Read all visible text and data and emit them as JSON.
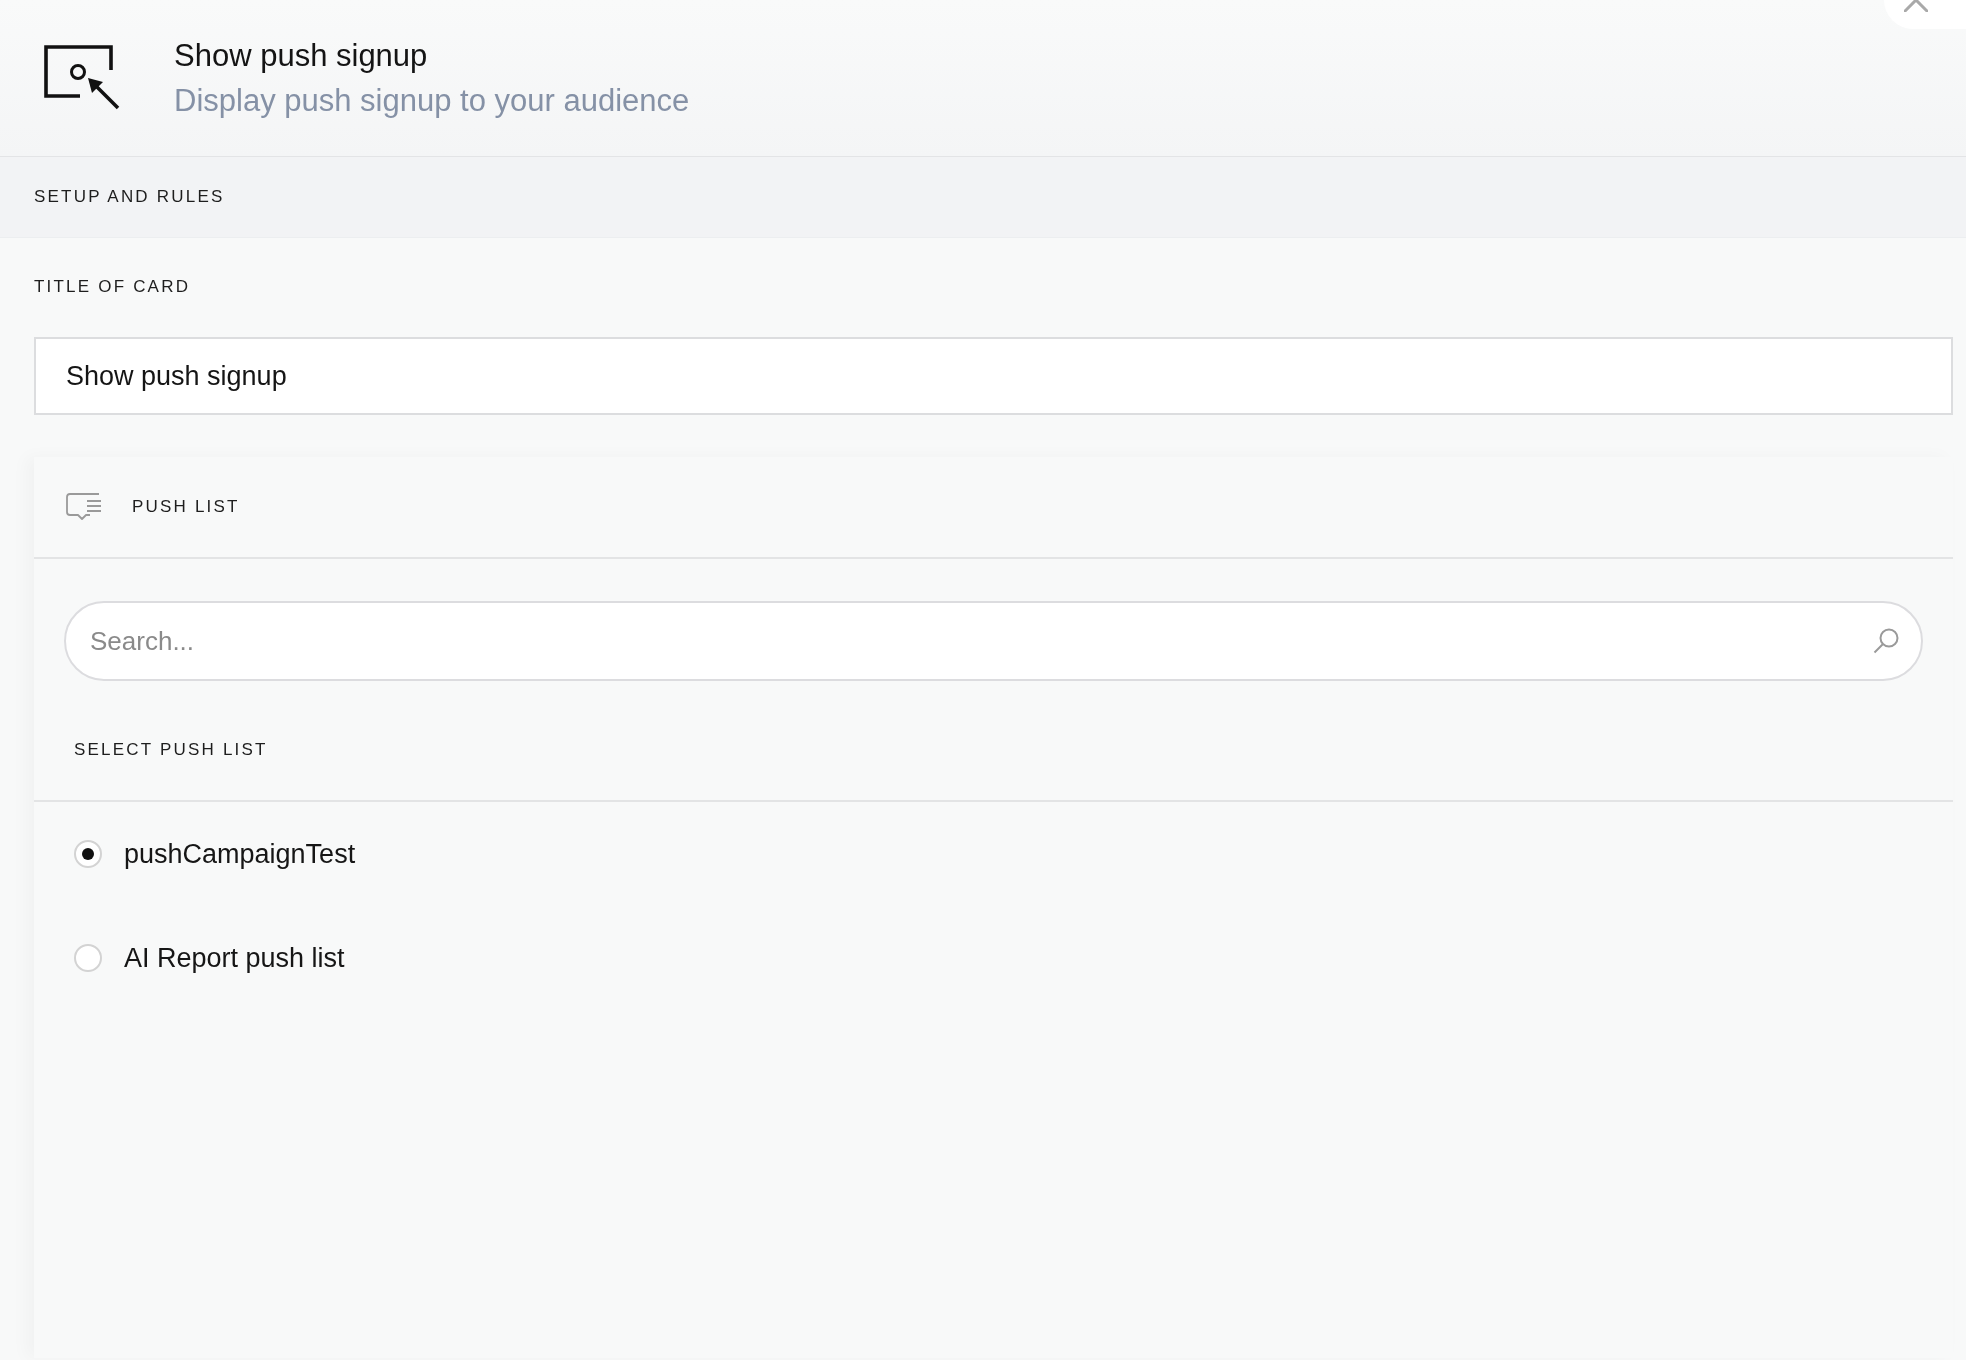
{
  "header": {
    "title": "Show push signup",
    "subtitle": "Display push signup to your audience"
  },
  "section": {
    "label": "SETUP AND RULES"
  },
  "title_field": {
    "label": "TITLE OF CARD",
    "value": "Show push signup"
  },
  "push_list": {
    "heading": "PUSH LIST",
    "search": {
      "placeholder": "Search..."
    },
    "list_label": "SELECT PUSH LIST",
    "options": [
      {
        "label": "pushCampaignTest",
        "selected": true
      },
      {
        "label": "AI Report push list",
        "selected": false
      }
    ]
  }
}
